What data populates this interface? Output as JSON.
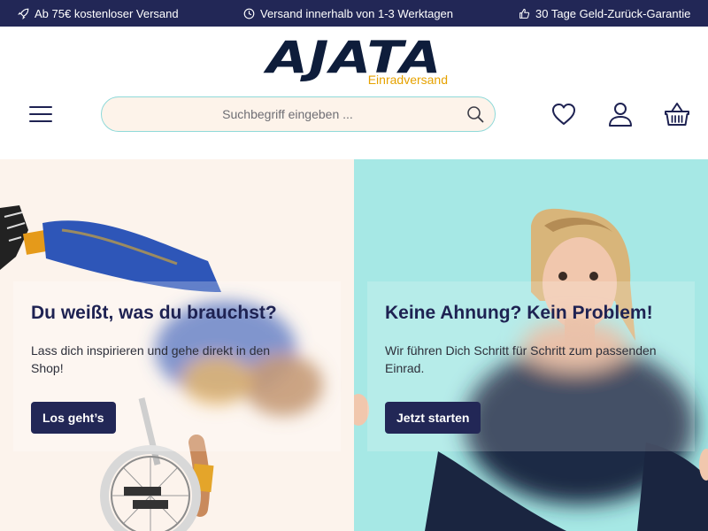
{
  "topbar": {
    "usp1": {
      "icon": "rocket-icon",
      "text": "Ab 75€ kostenloser Versand"
    },
    "usp2": {
      "icon": "clock-icon",
      "text": "Versand innerhalb von 1-3 Werktagen"
    },
    "usp3": {
      "icon": "thumbs-up-icon",
      "text": "30 Tage Geld-Zurück-Garantie"
    }
  },
  "header": {
    "logo": {
      "main": "AJATA",
      "sub": "Einradversand"
    },
    "menu_icon": "hamburger-menu-icon",
    "search": {
      "placeholder": "Suchbegriff eingeben ...",
      "value": "",
      "icon": "search-icon"
    },
    "icons": {
      "wishlist": "heart-icon",
      "account": "user-icon",
      "cart": "basket-icon"
    }
  },
  "hero": {
    "left": {
      "title": "Du weißt, was du brauchst?",
      "text": "Lass dich inspirieren und gehe direkt in den Shop!",
      "button": "Los geht’s"
    },
    "right": {
      "title": "Keine Ahnung? Kein Problem!",
      "text": "Wir führen Dich Schritt für Schritt zum passenden Einrad.",
      "button": "Jetzt starten"
    }
  },
  "colors": {
    "topbar": "#222756",
    "primary": "#222756",
    "accent_logo": "#e6a200",
    "hero_left_bg": "#fcf3ec",
    "hero_right_bg": "#a6e8e5",
    "search_bg": "#fdf3ea",
    "search_border": "#8fd9d9"
  }
}
